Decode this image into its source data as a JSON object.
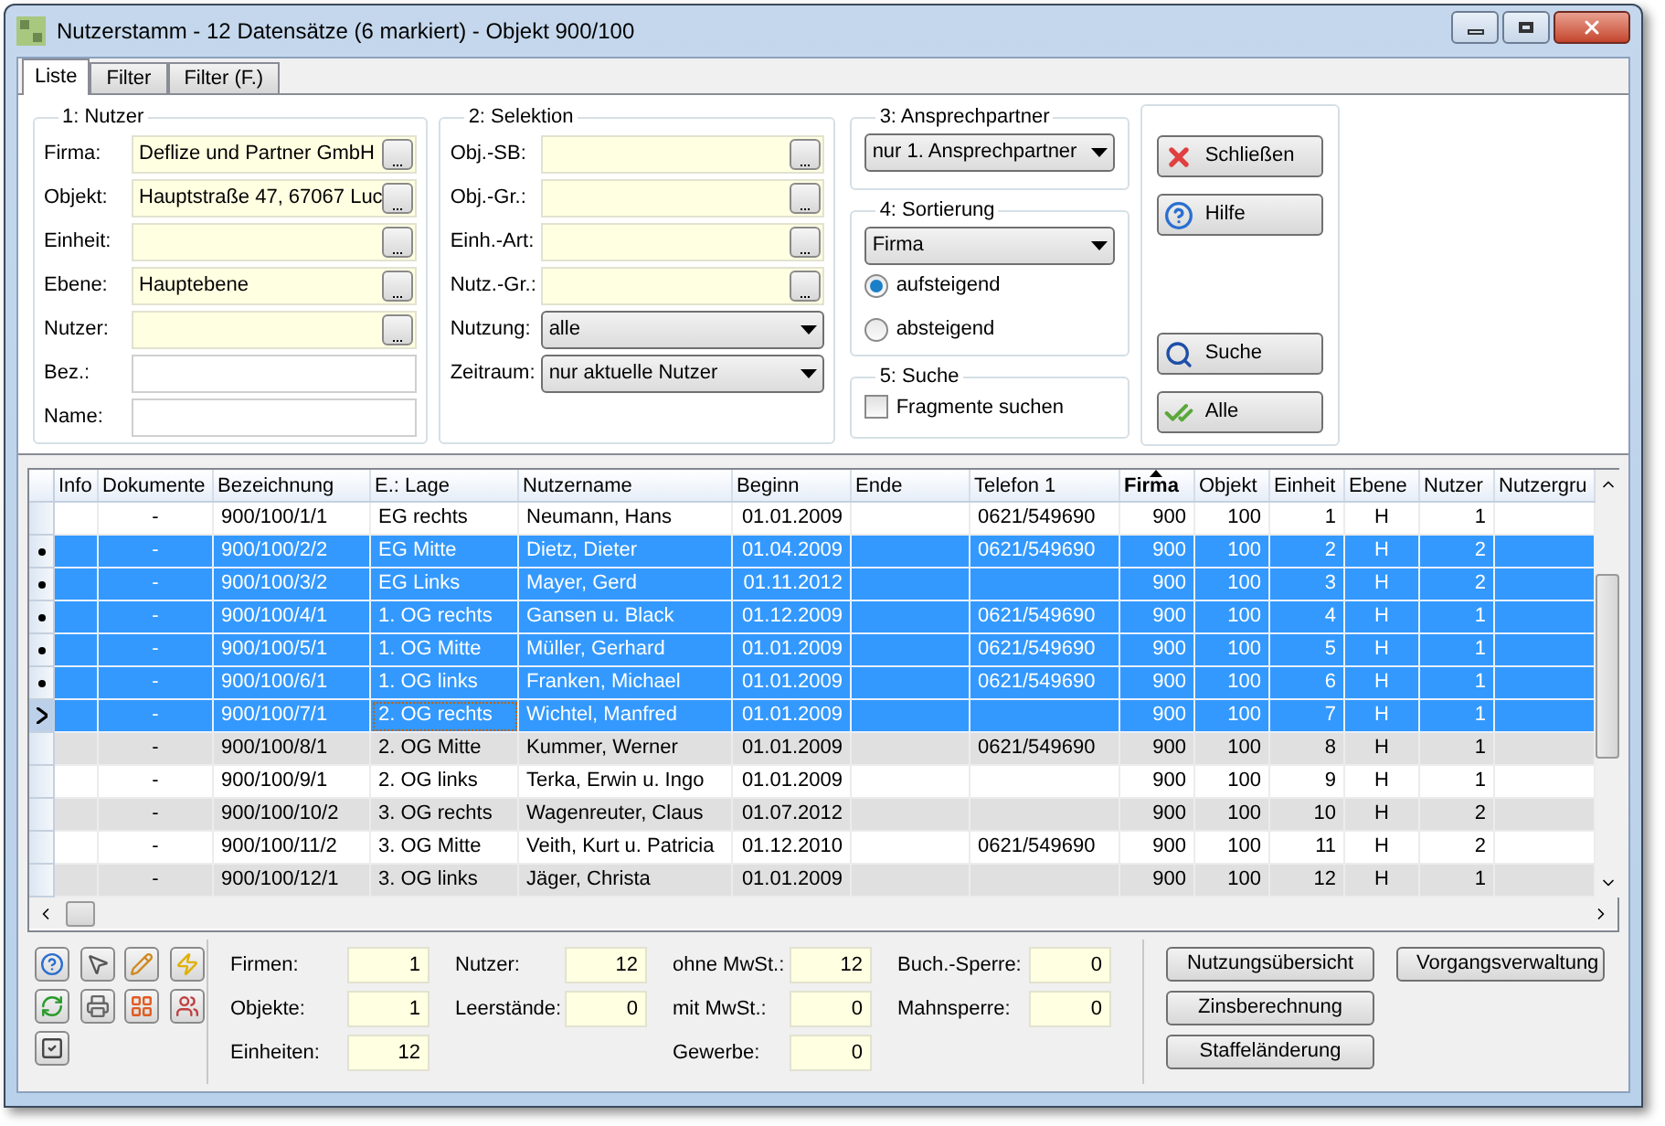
{
  "window": {
    "title": "Nutzerstamm - 12 Datensätze (6 markiert) - Objekt 900/100"
  },
  "tabs": [
    {
      "label": "Liste",
      "selected": true
    },
    {
      "label": "Filter",
      "selected": false
    },
    {
      "label": "Filter (F.)",
      "selected": false
    }
  ],
  "nutzer_group": {
    "title": "1: Nutzer",
    "fields": [
      {
        "label": "Firma:",
        "kind": "lookup",
        "value": "Deflize und Partner GmbH"
      },
      {
        "label": "Objekt:",
        "kind": "lookup",
        "value": "Hauptstraße 47, 67067 Luc"
      },
      {
        "label": "Einheit:",
        "kind": "lookup"
      },
      {
        "label": "Ebene:",
        "kind": "lookup",
        "value": "Hauptebene"
      },
      {
        "label": "Nutzer:",
        "kind": "lookup"
      },
      {
        "label": "Bez.:",
        "kind": "text"
      },
      {
        "label": "Name:",
        "kind": "text"
      }
    ]
  },
  "selektion_group": {
    "title": "2: Selektion",
    "fields": [
      {
        "label": "Obj.-SB:",
        "kind": "lookup"
      },
      {
        "label": "Obj.-Gr.:",
        "kind": "lookup"
      },
      {
        "label": "Einh.-Art:",
        "kind": "lookup"
      },
      {
        "label": "Nutz.-Gr.:",
        "kind": "lookup"
      },
      {
        "label": "Nutzung:",
        "kind": "select",
        "value": "alle"
      },
      {
        "label": "Zeitraum:",
        "kind": "select",
        "value": "nur aktuelle Nutzer"
      }
    ]
  },
  "ansprechpartner": {
    "title": "3: Ansprechpartner",
    "value": "nur 1. Ansprechpartner"
  },
  "sortierung": {
    "title": "4: Sortierung",
    "value": "Firma",
    "options": [
      {
        "label": "aufsteigend",
        "selected": true
      },
      {
        "label": "absteigend",
        "selected": false
      }
    ]
  },
  "suche": {
    "title": "5: Suche",
    "checkbox": {
      "label": "Fragmente suchen",
      "checked": false
    }
  },
  "action_buttons": [
    {
      "label": "Schließen",
      "kind": "close"
    },
    {
      "label": "Hilfe",
      "kind": "help"
    },
    {
      "label": "Suche",
      "kind": "search"
    },
    {
      "label": "Alle",
      "kind": "all"
    }
  ],
  "table": {
    "columns": [
      {
        "label": "Info",
        "sorted": false
      },
      {
        "label": "Dokumente",
        "sorted": false
      },
      {
        "label": "Bezeichnung",
        "sorted": false
      },
      {
        "label": "E.: Lage",
        "sorted": false
      },
      {
        "label": "Nutzername",
        "sorted": false
      },
      {
        "label": "Beginn",
        "sorted": false
      },
      {
        "label": "Ende",
        "sorted": false
      },
      {
        "label": "Telefon 1",
        "sorted": false
      },
      {
        "label": "Firma",
        "sorted": true
      },
      {
        "label": "Objekt",
        "sorted": false
      },
      {
        "label": "Einheit",
        "sorted": false
      },
      {
        "label": "Ebene",
        "sorted": false
      },
      {
        "label": "Nutzer",
        "sorted": false
      },
      {
        "label": "Nutzergru",
        "sorted": false
      }
    ],
    "rows": [
      {
        "dokumente": "-",
        "bezeichnung": "900/100/1/1",
        "lage": "EG rechts",
        "nutzername": "Neumann, Hans",
        "beginn": "01.01.2009",
        "telefon": "0621/549690",
        "firma": "900",
        "objekt": "100",
        "einheit": "1",
        "ebene": "H",
        "nutzer": "1",
        "selected": false,
        "current": false
      },
      {
        "dokumente": "-",
        "bezeichnung": "900/100/2/2",
        "lage": "EG Mitte",
        "nutzername": "Dietz, Dieter",
        "beginn": "01.04.2009",
        "telefon": "0621/549690",
        "firma": "900",
        "objekt": "100",
        "einheit": "2",
        "ebene": "H",
        "nutzer": "2",
        "selected": true,
        "current": false
      },
      {
        "dokumente": "-",
        "bezeichnung": "900/100/3/2",
        "lage": "EG Links",
        "nutzername": "Mayer, Gerd",
        "beginn": "01.11.2012",
        "firma": "900",
        "objekt": "100",
        "einheit": "3",
        "ebene": "H",
        "nutzer": "2",
        "selected": true,
        "current": false
      },
      {
        "dokumente": "-",
        "bezeichnung": "900/100/4/1",
        "lage": "1. OG rechts",
        "nutzername": "Gansen u. Black",
        "beginn": "01.12.2009",
        "telefon": "0621/549690",
        "firma": "900",
        "objekt": "100",
        "einheit": "4",
        "ebene": "H",
        "nutzer": "1",
        "selected": true,
        "current": false
      },
      {
        "dokumente": "-",
        "bezeichnung": "900/100/5/1",
        "lage": "1. OG Mitte",
        "nutzername": "Müller, Gerhard",
        "beginn": "01.01.2009",
        "telefon": "0621/549690",
        "firma": "900",
        "objekt": "100",
        "einheit": "5",
        "ebene": "H",
        "nutzer": "1",
        "selected": true,
        "current": false
      },
      {
        "dokumente": "-",
        "bezeichnung": "900/100/6/1",
        "lage": "1. OG links",
        "nutzername": "Franken, Michael",
        "beginn": "01.01.2009",
        "telefon": "0621/549690",
        "firma": "900",
        "objekt": "100",
        "einheit": "6",
        "ebene": "H",
        "nutzer": "1",
        "selected": true,
        "current": false
      },
      {
        "dokumente": "-",
        "bezeichnung": "900/100/7/1",
        "lage": "2. OG rechts",
        "nutzername": "Wichtel, Manfred",
        "beginn": "01.01.2009",
        "firma": "900",
        "objekt": "100",
        "einheit": "7",
        "ebene": "H",
        "nutzer": "1",
        "selected": true,
        "current": true
      },
      {
        "dokumente": "-",
        "bezeichnung": "900/100/8/1",
        "lage": "2. OG Mitte",
        "nutzername": "Kummer, Werner",
        "beginn": "01.01.2009",
        "telefon": "0621/549690",
        "firma": "900",
        "objekt": "100",
        "einheit": "8",
        "ebene": "H",
        "nutzer": "1",
        "selected": false,
        "current": false
      },
      {
        "dokumente": "-",
        "bezeichnung": "900/100/9/1",
        "lage": "2. OG links",
        "nutzername": "Terka, Erwin u. Ingo",
        "beginn": "01.01.2009",
        "firma": "900",
        "objekt": "100",
        "einheit": "9",
        "ebene": "H",
        "nutzer": "1",
        "selected": false,
        "current": false
      },
      {
        "dokumente": "-",
        "bezeichnung": "900/100/10/2",
        "lage": "3. OG rechts",
        "nutzername": "Wagenreuter, Claus",
        "beginn": "01.07.2012",
        "firma": "900",
        "objekt": "100",
        "einheit": "10",
        "ebene": "H",
        "nutzer": "2",
        "selected": false,
        "current": false
      },
      {
        "dokumente": "-",
        "bezeichnung": "900/100/11/2",
        "lage": "3. OG Mitte",
        "nutzername": "Veith, Kurt u. Patricia",
        "beginn": "01.12.2010",
        "telefon": "0621/549690",
        "firma": "900",
        "objekt": "100",
        "einheit": "11",
        "ebene": "H",
        "nutzer": "2",
        "selected": false,
        "current": false
      },
      {
        "dokumente": "-",
        "bezeichnung": "900/100/12/1",
        "lage": "3. OG links",
        "nutzername": "Jäger, Christa",
        "beginn": "01.01.2009",
        "firma": "900",
        "objekt": "100",
        "einheit": "12",
        "ebene": "H",
        "nutzer": "1",
        "selected": false,
        "current": false
      }
    ]
  },
  "statistics": [
    [
      {
        "label": "Firmen:",
        "value": "1"
      },
      {
        "label": "Objekte:",
        "value": "1"
      },
      {
        "label": "Einheiten:",
        "value": "12"
      }
    ],
    [
      {
        "label": "Nutzer:",
        "value": "12"
      },
      {
        "label": "Leerstände:",
        "value": "0"
      }
    ],
    [
      {
        "label": "ohne MwSt.:",
        "value": "12"
      },
      {
        "label": "mit MwSt.:",
        "value": "0"
      },
      {
        "label": "Gewerbe:",
        "value": "0"
      }
    ],
    [
      {
        "label": "Buch.-Sperre:",
        "value": "0"
      },
      {
        "label": "Mahnsperre:",
        "value": "0"
      }
    ]
  ],
  "report_buttons": [
    [
      "Nutzungsübersicht",
      "Zinsberechnung",
      "Staffeländerung"
    ],
    [
      "Vorgangsverwaltung"
    ]
  ]
}
